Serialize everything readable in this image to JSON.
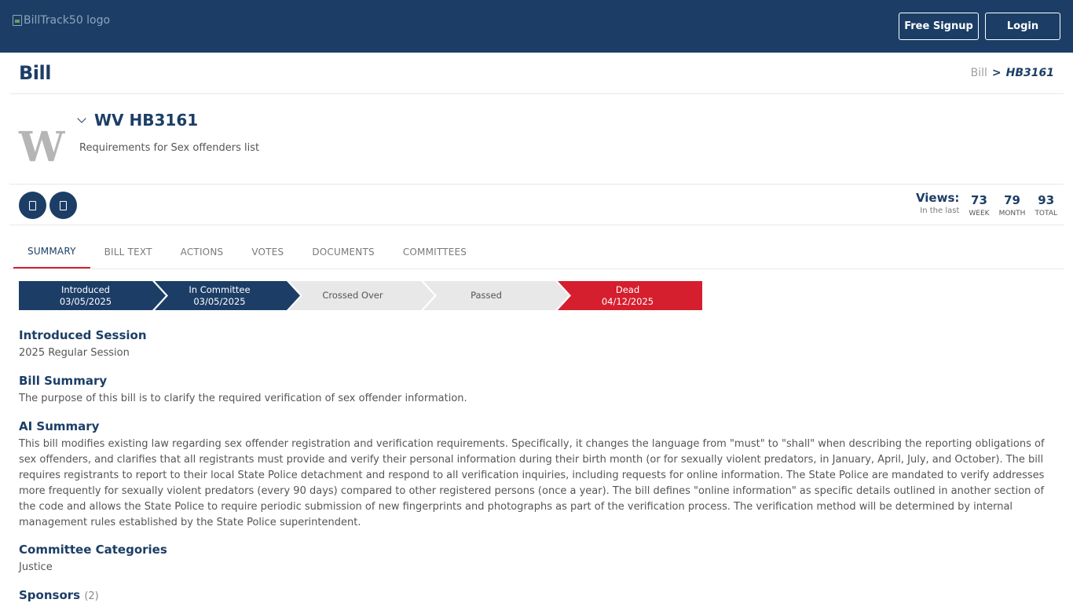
{
  "header": {
    "logo_alt": "BillTrack50 logo",
    "signup_label": "Free Signup",
    "login_label": "Login",
    "brand_color": "#1c3e66"
  },
  "page": {
    "title": "Bill",
    "breadcrumb": {
      "link": "Bill",
      "separator": ">",
      "current": "HB3161"
    }
  },
  "bill": {
    "state_letter": "W",
    "id": "WV HB3161",
    "description": "Requirements for Sex offenders list"
  },
  "actions": {
    "button1_icon": "bookmark-icon",
    "button2_icon": "share-icon"
  },
  "views": {
    "label": "Views:",
    "sub": "In the last",
    "week": {
      "value": "73",
      "caption": "WEEK"
    },
    "month": {
      "value": "79",
      "caption": "MONTH"
    },
    "total": {
      "value": "93",
      "caption": "TOTAL"
    }
  },
  "tabs": [
    {
      "label": "SUMMARY",
      "active": true
    },
    {
      "label": "BILL TEXT",
      "active": false
    },
    {
      "label": "ACTIONS",
      "active": false
    },
    {
      "label": "VOTES",
      "active": false
    },
    {
      "label": "DOCUMENTS",
      "active": false
    },
    {
      "label": "COMMITTEES",
      "active": false
    }
  ],
  "progress": {
    "colors": {
      "done": "#1c3e66",
      "pending": "#e8e8e8",
      "dead": "#d51f2e"
    },
    "steps": [
      {
        "label": "Introduced",
        "date": "03/05/2025",
        "status": "done"
      },
      {
        "label": "In Committee",
        "date": "03/05/2025",
        "status": "done"
      },
      {
        "label": "Crossed Over",
        "date": "",
        "status": "pending"
      },
      {
        "label": "Passed",
        "date": "",
        "status": "pending"
      },
      {
        "label": "Dead",
        "date": "04/12/2025",
        "status": "dead"
      }
    ]
  },
  "summary": {
    "session_heading": "Introduced Session",
    "session_value": "2025 Regular Session",
    "bill_summary_heading": "Bill Summary",
    "bill_summary_text": "The purpose of this bill is to clarify the required verification of sex offender information.",
    "ai_heading": "AI Summary",
    "ai_text": "This bill modifies existing law regarding sex offender registration and verification requirements. Specifically, it changes the language from \"must\" to \"shall\" when describing the reporting obligations of sex offenders, and clarifies that all registrants must provide and verify their personal information during their birth month (or for sexually violent predators, in January, April, July, and October). The bill requires registrants to report to their local State Police detachment and respond to all verification inquiries, including requests for online information. The State Police are mandated to verify addresses more frequently for sexually violent predators (every 90 days) compared to other registered persons (once a year). The bill defines \"online information\" as specific details outlined in another section of the code and allows the State Police to require periodic submission of new fingerprints and photographs as part of the verification process. The verification method will be determined by internal management rules established by the State Police superintendent.",
    "committee_heading": "Committee Categories",
    "committee_value": "Justice",
    "sponsors_heading": "Sponsors",
    "sponsors_count": "(2)"
  }
}
